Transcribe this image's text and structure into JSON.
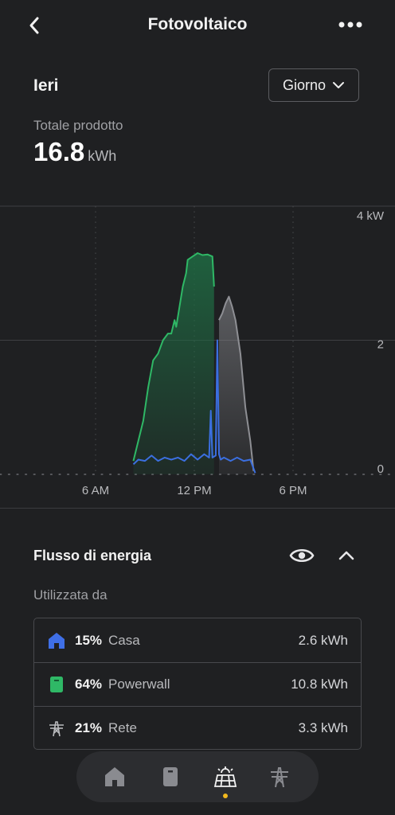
{
  "header": {
    "title": "Fotovoltaico",
    "back_icon": "chevron-left-icon",
    "more_icon": "more-horizontal-icon"
  },
  "summary": {
    "period_label": "Ieri",
    "range_select": "Giorno",
    "total_label": "Totale prodotto",
    "total_value": "16.8",
    "total_unit": "kWh"
  },
  "chart_data": {
    "type": "area",
    "y_tick_labels": [
      "4 kW",
      "2",
      "0"
    ],
    "x_tick_labels": [
      "6 AM",
      "12 PM",
      "6 PM"
    ],
    "ylim": [
      0,
      4
    ],
    "xlim": [
      0,
      24
    ],
    "grid": true,
    "colors": {
      "powerwall": "#2fb866",
      "grid": "#8e8f94",
      "home": "#3b6fe0"
    },
    "series": [
      {
        "x": [
          8.3,
          8.6,
          8.9,
          9.2,
          9.5,
          9.8,
          10.1,
          10.4,
          10.6,
          10.8,
          10.9,
          11.1,
          11.3,
          11.5,
          11.6,
          11.9,
          12.2,
          12.5,
          12.8,
          13.1,
          13.2
        ],
        "y": [
          0.2,
          0.5,
          0.8,
          1.3,
          1.7,
          1.8,
          2.0,
          2.1,
          2.1,
          2.3,
          2.2,
          2.5,
          2.8,
          3.0,
          3.2,
          3.25,
          3.3,
          3.27,
          3.28,
          3.25,
          2.8
        ]
      },
      {
        "x": [
          13.5,
          13.7,
          13.9,
          14.1,
          14.3,
          14.5,
          14.8,
          15.1,
          15.4,
          15.6
        ],
        "y": [
          2.3,
          2.4,
          2.55,
          2.65,
          2.5,
          2.3,
          1.8,
          1.0,
          0.5,
          0.05
        ]
      },
      {
        "x": [
          8.3,
          8.6,
          9.0,
          9.4,
          9.8,
          10.2,
          10.6,
          11.0,
          11.4,
          11.8,
          12.2,
          12.6,
          12.9,
          13.0,
          13.1,
          13.3,
          13.4,
          13.5,
          13.6,
          13.8,
          14.2,
          14.6,
          15.0,
          15.4,
          15.7
        ],
        "y": [
          0.15,
          0.22,
          0.2,
          0.28,
          0.2,
          0.25,
          0.22,
          0.25,
          0.2,
          0.3,
          0.22,
          0.3,
          0.25,
          0.95,
          0.25,
          0.28,
          2.0,
          0.3,
          0.22,
          0.25,
          0.2,
          0.25,
          0.2,
          0.22,
          0.02
        ]
      }
    ]
  },
  "energy_flow": {
    "title": "Flusso di energia",
    "eye_icon": "eye-icon",
    "collapse_icon": "chevron-up-icon",
    "used_by_label": "Utilizzata da",
    "rows": [
      {
        "icon": "home-icon",
        "percent": "15%",
        "label": "Casa",
        "value": "2.6 kWh"
      },
      {
        "icon": "powerwall-icon",
        "percent": "64%",
        "label": "Powerwall",
        "value": "10.8 kWh"
      },
      {
        "icon": "grid-tower-icon",
        "percent": "21%",
        "label": "Rete",
        "value": "3.3 kWh"
      }
    ]
  },
  "bottom_nav": {
    "items": [
      "home-icon",
      "powerwall-icon",
      "solar-panel-icon",
      "grid-tower-icon"
    ],
    "active_item": "solar-panel-icon"
  }
}
